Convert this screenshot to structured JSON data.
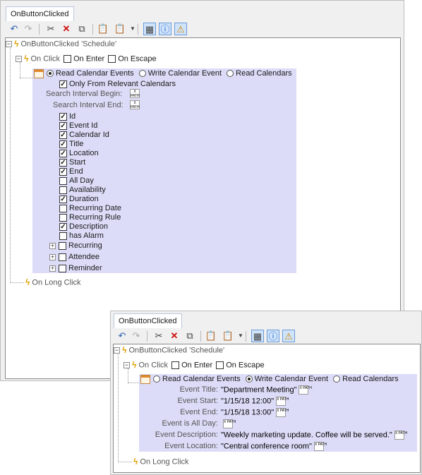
{
  "win1": {
    "tab": "OnButtonClicked",
    "root": "OnButtonClicked 'Schedule'",
    "on_click": "On Click",
    "on_enter": "On Enter",
    "on_escape": "On Escape",
    "radios": [
      "Read Calendar Events",
      "Write Calendar Event",
      "Read Calendars"
    ],
    "only_relevant": "Only From Relevant Calendars",
    "search_begin": "Search Interval Begin:",
    "search_end": "Search Interval End:",
    "fields": [
      {
        "label": "Id",
        "checked": true
      },
      {
        "label": "Event Id",
        "checked": true
      },
      {
        "label": "Calendar Id",
        "checked": true
      },
      {
        "label": "Title",
        "checked": true
      },
      {
        "label": "Location",
        "checked": true
      },
      {
        "label": "Start",
        "checked": true
      },
      {
        "label": "End",
        "checked": true
      },
      {
        "label": "All Day",
        "checked": false
      },
      {
        "label": "Availability",
        "checked": false
      },
      {
        "label": "Duration",
        "checked": true
      },
      {
        "label": "Recurring Date",
        "checked": false
      },
      {
        "label": "Recurring Rule",
        "checked": false
      },
      {
        "label": "Description",
        "checked": true
      },
      {
        "label": "has Alarm",
        "checked": false
      }
    ],
    "expandable": [
      "Recurring",
      "Attendee",
      "Reminder"
    ],
    "on_long_click": "On Long Click"
  },
  "win2": {
    "tab": "OnButtonClicked",
    "root": "OnButtonClicked 'Schedule'",
    "on_click": "On Click",
    "on_enter": "On Enter",
    "on_escape": "On Escape",
    "radios": [
      "Read Calendar Events",
      "Write Calendar Event",
      "Read Calendars"
    ],
    "props": [
      {
        "label": "Event Title:",
        "value": "\"Department Meeting\""
      },
      {
        "label": "Event Start:",
        "value": "\"1/15/18 12:00\""
      },
      {
        "label": "Event End:",
        "value": "\"1/15/18 13:00\""
      },
      {
        "label": "Event is All Day:",
        "value": ""
      },
      {
        "label": "Event Description:",
        "value": "\"Weekly marketing update. Coffee will be served.\""
      },
      {
        "label": "Event Location:",
        "value": "\"Central conference room\""
      }
    ],
    "on_long_click": "On Long Click"
  },
  "xpath_label": "X PATH",
  "colors": {
    "panel": "#dcdcf8",
    "bolt": "#e0a000",
    "highlight": "#cfe3fb"
  }
}
